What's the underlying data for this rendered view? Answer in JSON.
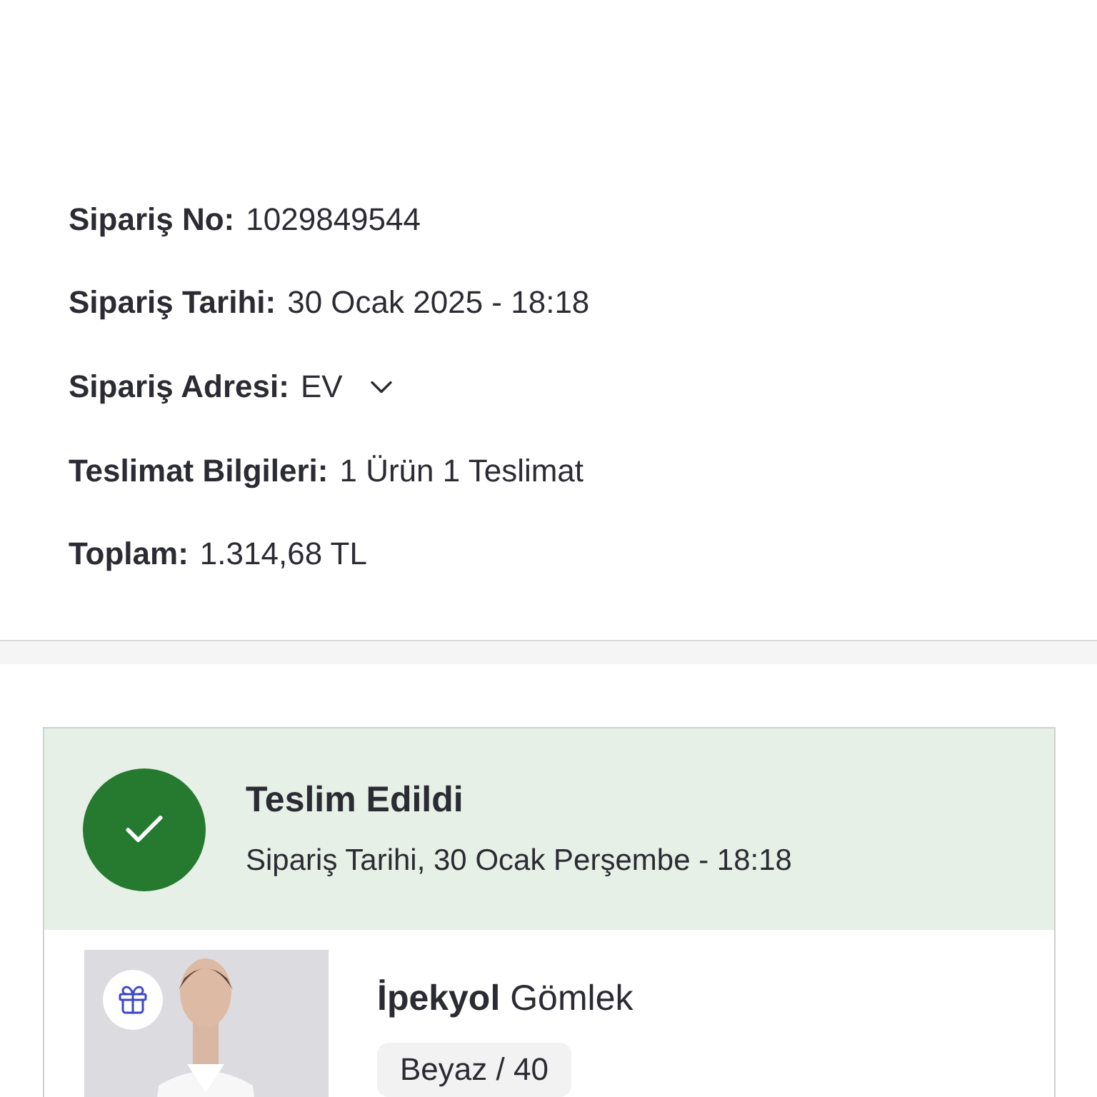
{
  "order_info": [
    {
      "kind": "text",
      "label": "Sipariş No:",
      "value": "1029849544"
    },
    {
      "kind": "text",
      "label": "Sipariş Tarihi:",
      "value": "30 Ocak 2025 - 18:18"
    },
    {
      "kind": "dropdown",
      "label": "Sipariş Adresi:",
      "value": "EV",
      "expanded": false
    },
    {
      "kind": "text",
      "label": "Teslimat Bilgileri:",
      "value": "1 Ürün 1 Teslimat"
    },
    {
      "kind": "text",
      "label": "Toplam:",
      "value": "1.314,68 TL"
    }
  ],
  "delivery": {
    "status": "Teslim Edildi",
    "subtitle": "Sipariş Tarihi, 30 Ocak Perşembe - 18:18",
    "items": [
      {
        "name": "**İpekyol** Gömlek",
        "variant": "Beyaz / 40",
        "gift": true
      }
    ]
  }
}
